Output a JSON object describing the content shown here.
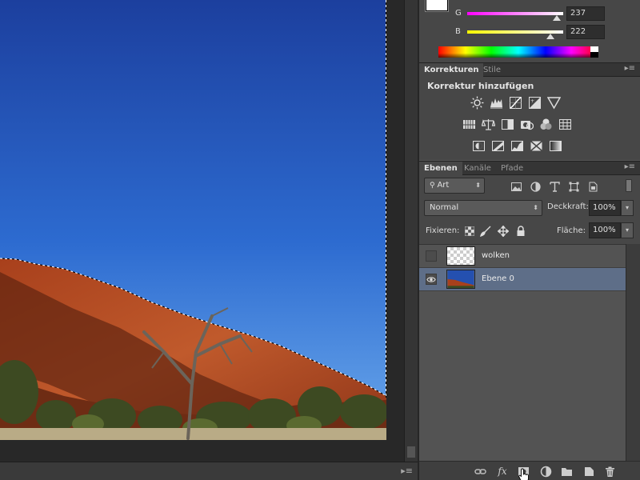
{
  "color_panel": {
    "sliders": [
      {
        "label": "G",
        "value": "237",
        "level": 0.93,
        "gradient_from": "#ff00ff",
        "gradient_to": "#ffffff"
      },
      {
        "label": "B",
        "value": "222",
        "level": 0.87,
        "gradient_from": "#ffff00",
        "gradient_to": "#ffffff"
      }
    ]
  },
  "adjustments": {
    "tabs": [
      "Korrekturen",
      "Stile"
    ],
    "title": "Korrektur hinzufügen",
    "icons_row1": [
      "brightness-icon",
      "levels-icon",
      "curves-icon",
      "exposure-icon",
      "vibrance-icon"
    ],
    "icons_row2": [
      "hue-saturation-icon",
      "color-balance-icon",
      "black-white-icon",
      "photo-filter-icon",
      "channel-mixer-icon",
      "color-lookup-icon"
    ],
    "icons_row3": [
      "invert-icon",
      "posterize-icon",
      "threshold-icon",
      "selective-color-icon",
      "gradient-map-icon"
    ]
  },
  "layers": {
    "tabs": [
      "Ebenen",
      "Kanäle",
      "Pfade"
    ],
    "filter_kind": "Art",
    "blend_mode": "Normal",
    "opacity_label": "Deckkraft:",
    "opacity_value": "100%",
    "lock_label": "Fixieren:",
    "fill_label": "Fläche:",
    "fill_value": "100%",
    "items": [
      {
        "name": "wolken",
        "visible": false,
        "selected": false
      },
      {
        "name": "Ebene 0",
        "visible": true,
        "selected": true
      }
    ],
    "footer_fx": "fx"
  },
  "colors": {
    "sky_top": "#1c40a0",
    "sky_bottom": "#5e9ee6",
    "rock": "#b04a22",
    "selection": "#5e6e88"
  }
}
